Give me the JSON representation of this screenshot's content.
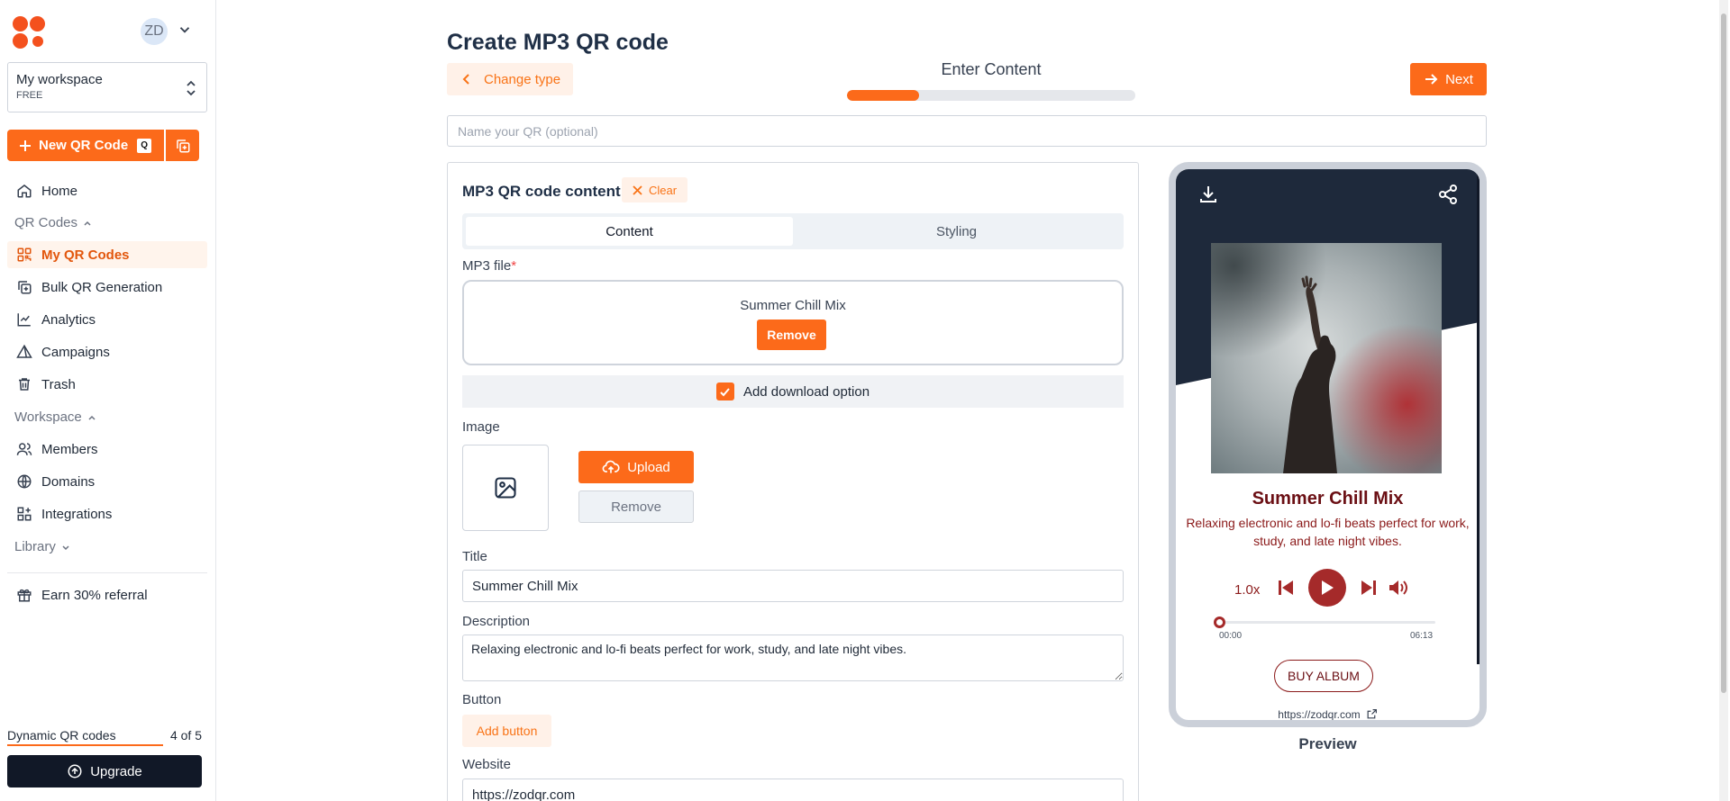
{
  "sidebar": {
    "avatar_initials": "ZD",
    "workspace": {
      "name": "My workspace",
      "plan": "FREE"
    },
    "new_qr": {
      "label": "New QR Code",
      "shortcut": "Q"
    },
    "home_label": "Home",
    "qr_group_label": "QR Codes",
    "qr_items": [
      {
        "label": "My QR Codes",
        "icon": "qr-grid-icon",
        "active": true
      },
      {
        "label": "Bulk QR Generation",
        "icon": "bulk-copy-icon"
      },
      {
        "label": "Analytics",
        "icon": "analytics-icon"
      },
      {
        "label": "Campaigns",
        "icon": "campaign-icon"
      },
      {
        "label": "Trash",
        "icon": "trash-icon"
      }
    ],
    "workspace_group_label": "Workspace",
    "workspace_items": [
      {
        "label": "Members",
        "icon": "members-icon"
      },
      {
        "label": "Domains",
        "icon": "globe-icon"
      },
      {
        "label": "Integrations",
        "icon": "integrations-icon"
      }
    ],
    "library_label": "Library",
    "referral_label": "Earn 30% referral",
    "quota": {
      "label": "Dynamic QR codes",
      "value": "4 of 5",
      "used": 4,
      "total": 5
    },
    "upgrade_label": "Upgrade"
  },
  "header": {
    "title": "Create MP3 QR code",
    "change_type_label": "Change type",
    "step_label": "Enter Content",
    "step_progress": 0.25,
    "next_label": "Next",
    "name_placeholder": "Name your QR (optional)"
  },
  "form": {
    "section_title": "MP3 QR code content",
    "clear_label": "Clear",
    "tabs": [
      "Content",
      "Styling"
    ],
    "active_tab": "Content",
    "mp3_label": "MP3 file",
    "required_mark": "*",
    "file_name": "Summer Chill Mix",
    "file_remove_label": "Remove",
    "download_option_label": "Add download option",
    "download_option_checked": true,
    "image_label": "Image",
    "upload_label": "Upload",
    "image_remove_label": "Remove",
    "title_label": "Title",
    "title_value": "Summer Chill Mix",
    "description_label": "Description",
    "description_value": "Relaxing electronic and lo-fi beats perfect for work, study, and late night vibes.",
    "button_label": "Button",
    "add_button_label": "Add button",
    "website_label": "Website",
    "website_value": "https://zodqr.com"
  },
  "preview": {
    "track_title": "Summer Chill Mix",
    "track_desc": "Relaxing electronic and lo-fi beats perfect for work, study, and late night vibes.",
    "speed": "1.0x",
    "time_current": "00:00",
    "time_total": "06:13",
    "buy_label": "BUY ALBUM",
    "url": "https://zodqr.com",
    "label": "Preview"
  },
  "colors": {
    "accent": "#fc6a1a",
    "dark": "#1e293b",
    "player": "#a52a2a"
  }
}
